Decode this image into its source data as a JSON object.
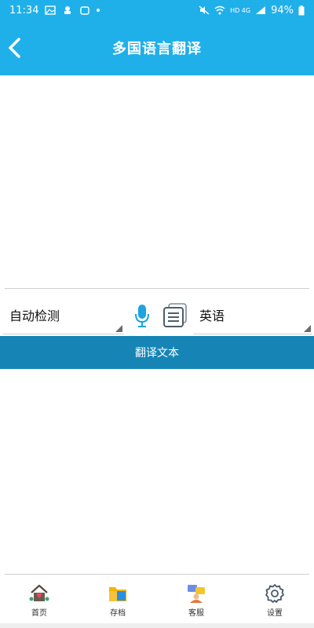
{
  "status_bar": {
    "time": "11:34",
    "battery": "94%",
    "network": "HD 4G"
  },
  "app_bar": {
    "title": "多国语言翻译"
  },
  "input": {
    "text": ""
  },
  "languages": {
    "source": "自动检测",
    "target": "英语"
  },
  "translate_button": {
    "label": "翻译文本"
  },
  "output": {
    "text": ""
  },
  "bottom_nav": {
    "items": [
      {
        "label": "首页",
        "icon": "home-icon"
      },
      {
        "label": "存档",
        "icon": "archive-icon"
      },
      {
        "label": "客服",
        "icon": "customer-service-icon"
      },
      {
        "label": "设置",
        "icon": "settings-icon"
      }
    ]
  },
  "colors": {
    "primary": "#1fb0ea",
    "button": "#1685b6"
  }
}
